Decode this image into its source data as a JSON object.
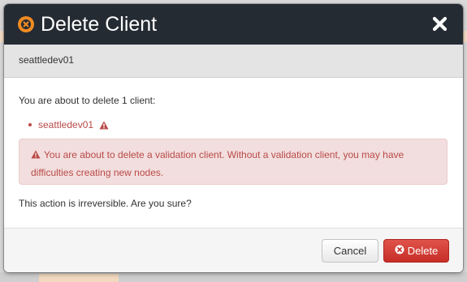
{
  "dialog": {
    "title": "Delete Client",
    "subheader": "seattledev01",
    "intro": "You are about to delete 1 client:",
    "clients": [
      "seattledev01"
    ],
    "alert": "You are about to delete a validation client. Without a validation client, you may have difficulties creating new nodes.",
    "confirm": "This action is irreversible. Are you sure?",
    "cancel_label": "Cancel",
    "delete_label": "Delete"
  },
  "colors": {
    "header_bg": "#252b33",
    "title_icon": "#f08b22",
    "danger_text": "#b94a48",
    "alert_bg": "#f2dede",
    "delete_button": "#d9443c"
  },
  "icons": {
    "title": "circle-x-icon",
    "close": "close-x-icon",
    "warning": "warning-triangle-icon",
    "delete": "circle-x-icon"
  }
}
